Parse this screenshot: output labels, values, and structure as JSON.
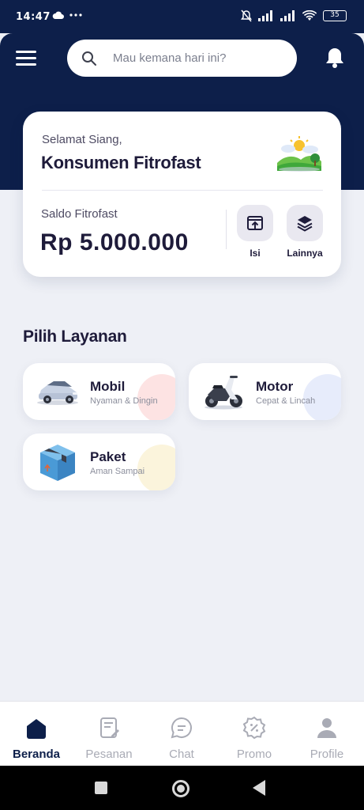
{
  "status_bar": {
    "time": "14:47",
    "battery": "35",
    "icons": [
      "cloud-icon",
      "more-dots-icon",
      "mute-icon",
      "signal-icon",
      "signal-icon",
      "wifi-icon",
      "battery-icon"
    ]
  },
  "header": {
    "menu_icon": "hamburger-menu-icon",
    "search_placeholder": "Mau kemana hari ini?",
    "search_icon": "search-icon",
    "notification_icon": "bell-icon"
  },
  "balance_card": {
    "greeting": "Selamat Siang,",
    "user_name": "Konsumen Fitrofast",
    "balance_label": "Saldo Fitrofast",
    "balance_value": "Rp 5.000.000",
    "actions": [
      {
        "label": "Isi",
        "icon": "top-up-icon"
      },
      {
        "label": "Lainnya",
        "icon": "layers-icon"
      }
    ]
  },
  "services": {
    "title": "Pilih Layanan",
    "items": [
      {
        "title": "Mobil",
        "subtitle": "Nyaman & Dingin",
        "icon": "car-icon",
        "accent": "#fde3e3"
      },
      {
        "title": "Motor",
        "subtitle": "Cepat & Lincah",
        "icon": "motorcycle-icon",
        "accent": "#e7ecfb"
      },
      {
        "title": "Paket",
        "subtitle": "Aman Sampai",
        "icon": "package-icon",
        "accent": "#fbf4dc"
      }
    ]
  },
  "bottom_nav": {
    "active": "Beranda",
    "items": [
      {
        "label": "Beranda",
        "icon": "home-icon"
      },
      {
        "label": "Pesanan",
        "icon": "orders-icon"
      },
      {
        "label": "Chat",
        "icon": "chat-icon"
      },
      {
        "label": "Promo",
        "icon": "promo-icon"
      },
      {
        "label": "Profile",
        "icon": "profile-icon"
      }
    ]
  },
  "colors": {
    "primary": "#0d1f4a",
    "background": "#eef0f6",
    "card": "#ffffff",
    "inactive": "#a9abb5"
  }
}
